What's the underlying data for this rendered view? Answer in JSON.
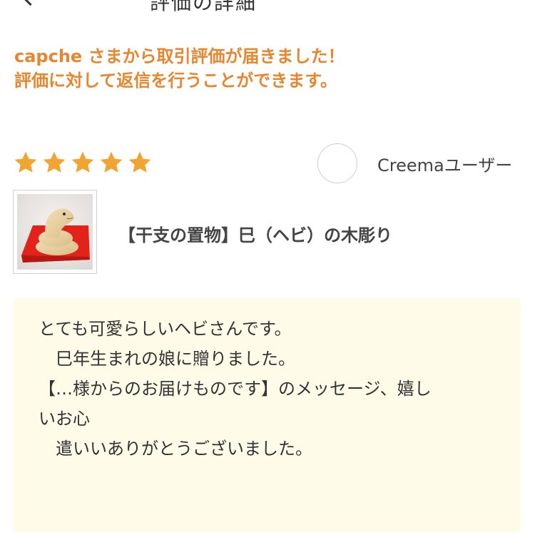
{
  "header": {
    "title": "評価の詳細"
  },
  "notice": {
    "line1": "capche さまから取引評価が届きました！",
    "line2": "評価に対して返信を行うことができます。",
    "color": "#e8862f"
  },
  "rating": {
    "stars": 5,
    "max": 5,
    "star_color": "#f0a431"
  },
  "reviewer": {
    "name": "Creemaユーザー"
  },
  "product": {
    "name": "【干支の置物】巳（ヘビ）の木彫り"
  },
  "review": {
    "lines": [
      "とても可愛らしいヘビさんです。",
      "　巳年生まれの娘に贈りました。",
      "【…様からのお届けものです】のメッセージ、嬉し",
      "いお心",
      "　遣いいありがとうございました。"
    ],
    "background": "#fefce9"
  }
}
